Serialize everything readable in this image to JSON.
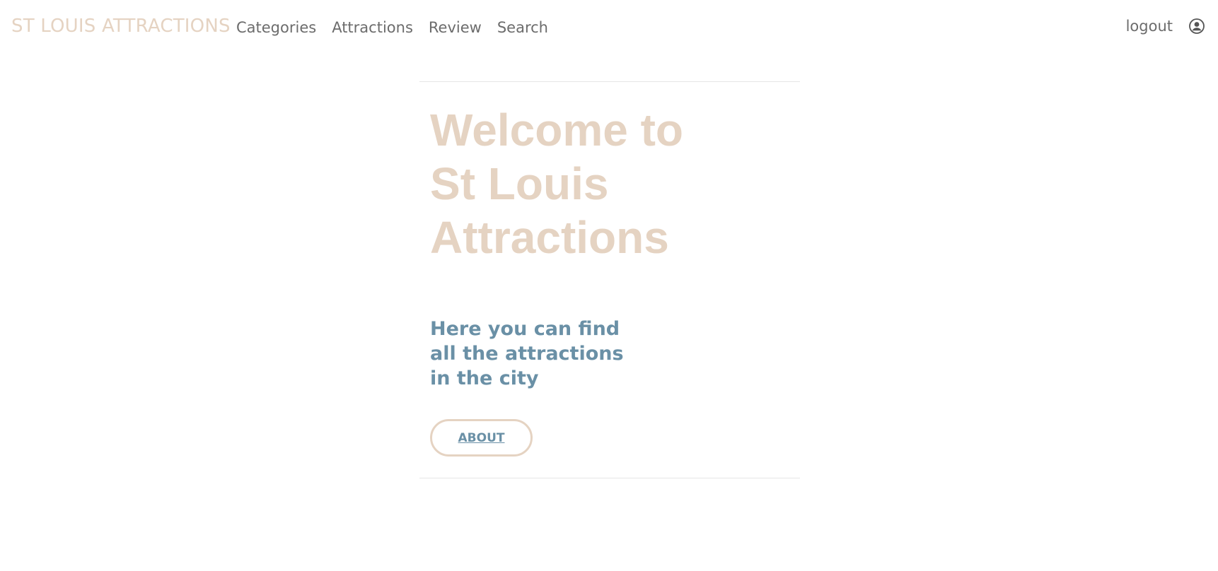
{
  "colors": {
    "brand": "#e5d3c2",
    "accent_blue": "#6a90a6",
    "nav_text": "#6c6c6c",
    "divider": "#e6e6e6"
  },
  "navbar": {
    "brand": "ST LOUIS ATTRACTIONS",
    "links": [
      {
        "label": "Categories"
      },
      {
        "label": "Attractions"
      },
      {
        "label": "Review"
      },
      {
        "label": "Search"
      }
    ],
    "logout_label": "logout",
    "user_icon": "user-circle-icon"
  },
  "hero": {
    "title": "Welcome to St Louis Attractions",
    "subtitle": "Here you can find all the attractions in the city",
    "about_button_label": "ABOUT"
  }
}
